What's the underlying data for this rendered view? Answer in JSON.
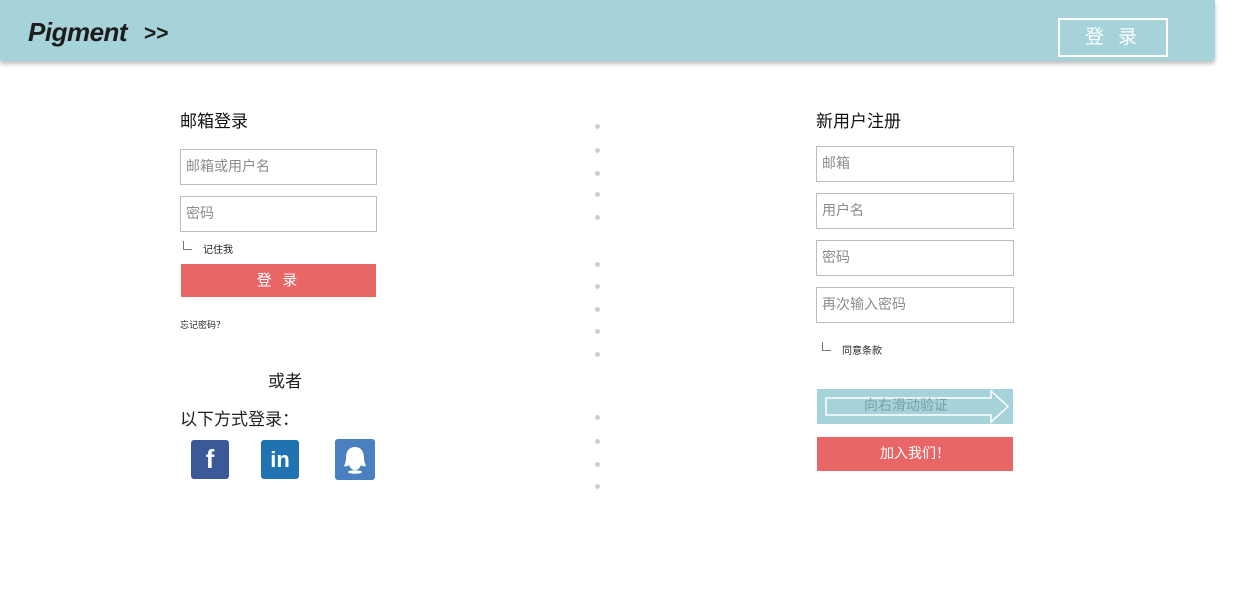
{
  "header": {
    "brand": "Pigment",
    "brand_arrow": ">>",
    "login_button": "登 录"
  },
  "login": {
    "title": "邮箱登录",
    "username_placeholder": "邮箱或用户名",
    "password_placeholder": "密码",
    "remember_label": "记住我",
    "submit_label": "登 录",
    "forgot_link": "忘记密码？",
    "or_text": "或者",
    "alt_login_label": "以下方式登录："
  },
  "social": {
    "facebook_glyph": "f",
    "linkedin_glyph": "in"
  },
  "register": {
    "title": "新用户注册",
    "email_placeholder": "邮箱",
    "username_placeholder": "用户名",
    "password_placeholder": "密码",
    "confirm_placeholder": "再次输入密码",
    "agree_label": "同意条款",
    "slider_label": "向右滑动验证",
    "submit_label": "加入我们！"
  },
  "colors": {
    "header_bg": "#a6d3da",
    "accent_red": "#e86666",
    "facebook": "#3b5998",
    "linkedin": "#1f73b1",
    "qq": "#4a7fc0"
  }
}
